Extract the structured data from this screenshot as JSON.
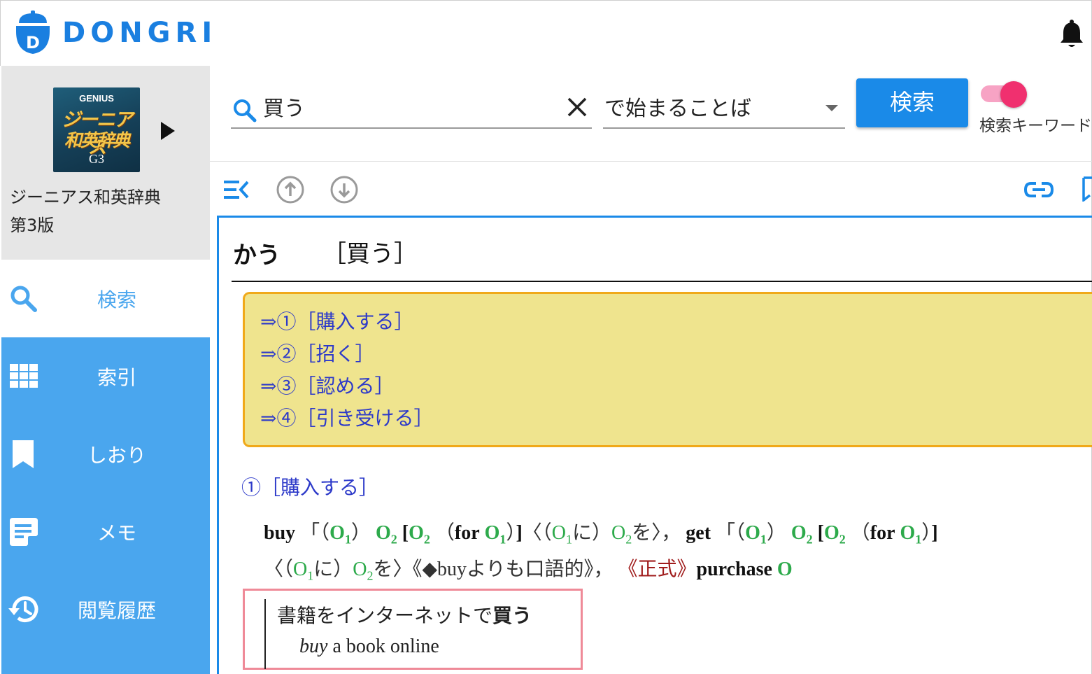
{
  "app": {
    "logo_text": "DONGRI"
  },
  "book": {
    "cover_brand": "GENIUS",
    "cover_title_line1": "ジーニアス",
    "cover_title_line2": "和英辞典",
    "cover_edition": "G3",
    "title_line1": "ジーニアス和英辞典",
    "title_line2": "第3版"
  },
  "nav": {
    "items": [
      {
        "label": "検索",
        "icon": "search-icon",
        "active": true
      },
      {
        "label": "索引",
        "icon": "grid-icon"
      },
      {
        "label": "しおり",
        "icon": "bookmark-icon"
      },
      {
        "label": "メモ",
        "icon": "memo-icon"
      },
      {
        "label": "閲覧履歴",
        "icon": "history-icon"
      }
    ]
  },
  "search": {
    "query": "買う",
    "mode": "で始まることば",
    "button_label": "検索",
    "toggle_label": "検索キーワード"
  },
  "entry": {
    "headword": "かう",
    "kanji": "［買う］",
    "senses": [
      "⇒①［購入する］",
      "⇒②［招く］",
      "⇒③［認める］",
      "⇒④［引き受ける］"
    ],
    "sense_heading": "①［購入する］",
    "example_ja_plain": "書籍をインターネットで",
    "example_ja_bold": "買う",
    "example_en_italic": "buy",
    "example_en_rest": " a book online"
  },
  "colors": {
    "brand": "#1a7fe0",
    "sidebar": "#4aa6ee",
    "link": "#2d3ac9",
    "pattern_green": "#2daa4b",
    "register_red": "#a01c1c",
    "sense_box_bg": "#efe48e",
    "sense_box_border": "#f0a91a",
    "example_border": "#ef8a98"
  }
}
